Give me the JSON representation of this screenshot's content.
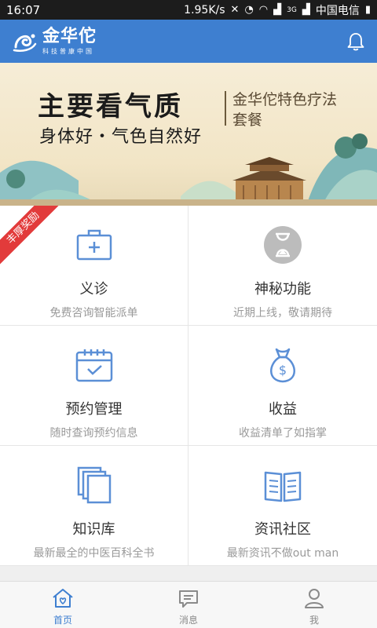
{
  "status_bar": {
    "time": "16:07",
    "speed": "1.95K/s",
    "carrier": "中国电信",
    "network": "3G"
  },
  "app_bar": {
    "logo_name": "金华佗",
    "logo_tagline": "科技普康中国",
    "icons": [
      "logo-icon",
      "bell-icon"
    ],
    "color": "#3e7fd0"
  },
  "banner": {
    "title": "主要看气质",
    "subtitle": "身体好・气色自然好",
    "side_text": "金华佗特色疗法套餐"
  },
  "grid": [
    {
      "title": "义诊",
      "desc": "免费咨询智能派单",
      "icon": "medical-kit-icon",
      "ribbon": "丰厚奖励"
    },
    {
      "title": "神秘功能",
      "desc": "近期上线，敬请期待",
      "icon": "hourglass-icon"
    },
    {
      "title": "预约管理",
      "desc": "随时查询预约信息",
      "icon": "calendar-icon"
    },
    {
      "title": "收益",
      "desc": "收益清单了如指掌",
      "icon": "money-bag-icon"
    },
    {
      "title": "知识库",
      "desc": "最新最全的中医百科全书",
      "icon": "documents-icon"
    },
    {
      "title": "资讯社区",
      "desc": "最新资讯不做out man",
      "icon": "book-icon"
    }
  ],
  "tabs": [
    {
      "label": "首页",
      "icon": "home-icon",
      "active": true
    },
    {
      "label": "消息",
      "icon": "message-icon",
      "active": false
    },
    {
      "label": "我",
      "icon": "profile-icon",
      "active": false
    }
  ],
  "colors": {
    "primary": "#3e7fd0",
    "ribbon": "#e23b3b",
    "icon": "#5b8fd6"
  }
}
